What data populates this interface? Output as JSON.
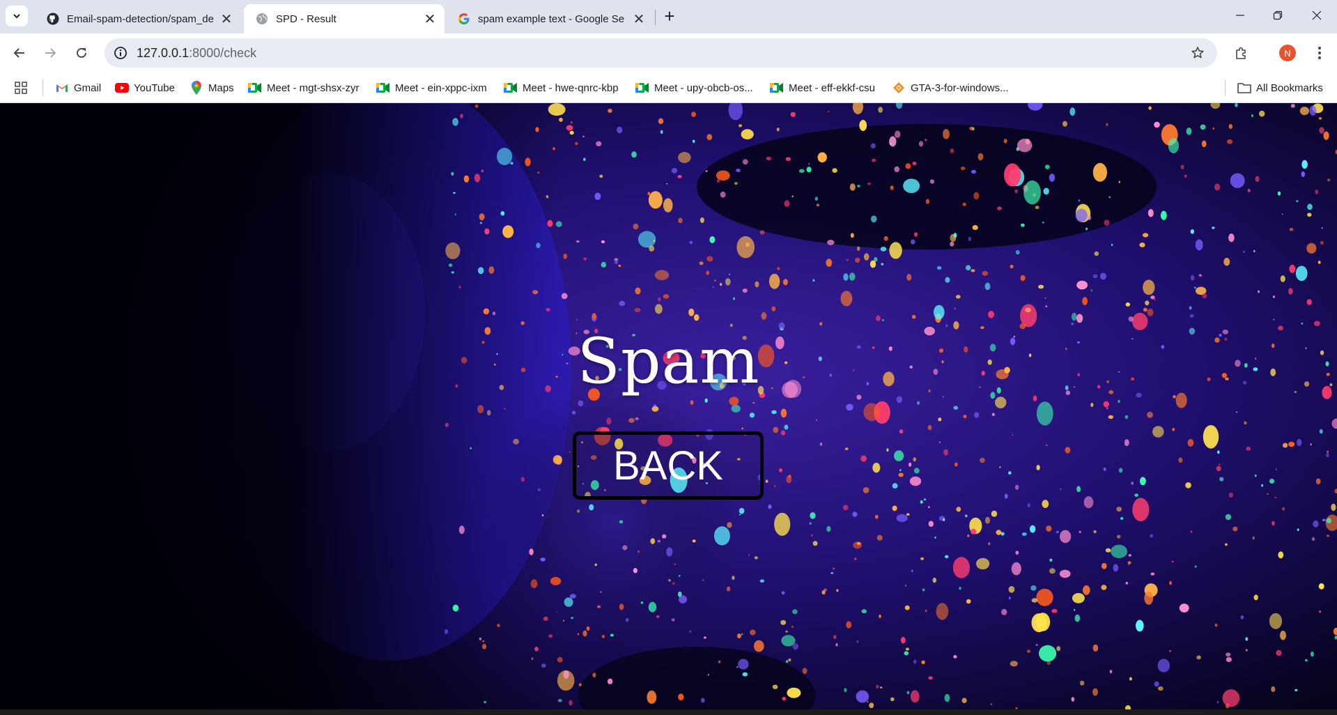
{
  "tabs": [
    {
      "title": "Email-spam-detection/spam_de",
      "icon": "github-icon",
      "active": false
    },
    {
      "title": "SPD - Result",
      "icon": "globe-icon",
      "active": true
    },
    {
      "title": "spam example text - Google Se",
      "icon": "google-icon",
      "active": false
    }
  ],
  "toolbar": {
    "url_host": "127.0.0.1",
    "url_path": ":8000/check",
    "profile_initial": "N"
  },
  "bookmarks": [
    {
      "label": "Gmail",
      "icon": "gmail-icon"
    },
    {
      "label": "YouTube",
      "icon": "youtube-icon"
    },
    {
      "label": "Maps",
      "icon": "maps-icon"
    },
    {
      "label": "Meet - mgt-shsx-zyr",
      "icon": "meet-icon"
    },
    {
      "label": "Meet - ein-xppc-ixm",
      "icon": "meet-icon"
    },
    {
      "label": "Meet - hwe-qnrc-kbp",
      "icon": "meet-icon"
    },
    {
      "label": "Meet - upy-obcb-os...",
      "icon": "meet-icon"
    },
    {
      "label": "Meet - eff-ekkf-csu",
      "icon": "meet-icon"
    },
    {
      "label": "GTA-3-for-windows...",
      "icon": "gta-icon"
    }
  ],
  "all_bookmarks_label": "All Bookmarks",
  "page": {
    "result": "Spam",
    "back_label": "BACK"
  },
  "colors": {
    "accent_profile": "#e8532d",
    "tabstrip_bg": "#dfe3ee",
    "button_border": "#000000",
    "text_on_image": "#ffffff"
  }
}
